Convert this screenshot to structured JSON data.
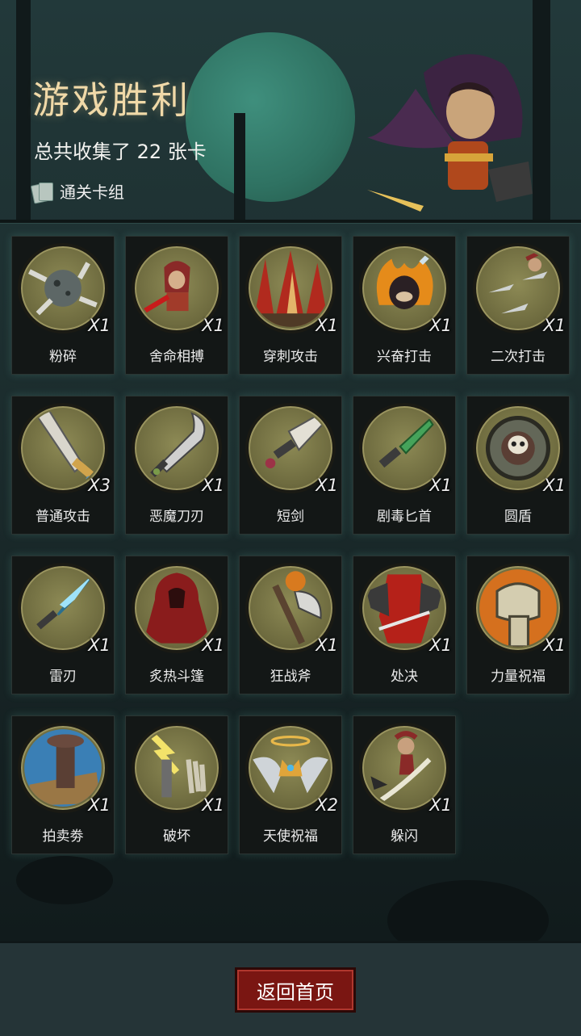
{
  "header": {
    "title": "游戏胜利",
    "subtitle": "总共收集了 22 张卡",
    "deck_label": "通关卡组"
  },
  "cards": [
    {
      "name": "粉碎",
      "count": "X1",
      "icon": "shattered-ball-icon"
    },
    {
      "name": "舍命相搏",
      "count": "X1",
      "icon": "hooded-fighter-icon"
    },
    {
      "name": "穿刺攻击",
      "count": "X1",
      "icon": "spike-trap-icon"
    },
    {
      "name": "兴奋打击",
      "count": "X1",
      "icon": "flaming-rogue-icon"
    },
    {
      "name": "二次打击",
      "count": "X1",
      "icon": "thrown-daggers-icon"
    },
    {
      "name": "普通攻击",
      "count": "X3",
      "icon": "broadsword-icon"
    },
    {
      "name": "恶魔刀刃",
      "count": "X1",
      "icon": "demon-blade-icon"
    },
    {
      "name": "短剑",
      "count": "X1",
      "icon": "short-sword-icon"
    },
    {
      "name": "剧毒匕首",
      "count": "X1",
      "icon": "poison-dagger-icon"
    },
    {
      "name": "圆盾",
      "count": "X1",
      "icon": "round-shield-icon"
    },
    {
      "name": "雷刃",
      "count": "X1",
      "icon": "thunder-blade-icon"
    },
    {
      "name": "炙热斗篷",
      "count": "X1",
      "icon": "red-cloak-icon"
    },
    {
      "name": "狂战斧",
      "count": "X1",
      "icon": "berserker-axe-icon"
    },
    {
      "name": "处决",
      "count": "X1",
      "icon": "execution-icon"
    },
    {
      "name": "力量祝福",
      "count": "X1",
      "icon": "fist-icon"
    },
    {
      "name": "拍卖劵",
      "count": "X1",
      "icon": "gavel-icon"
    },
    {
      "name": "破坏",
      "count": "X1",
      "icon": "lightning-hand-icon"
    },
    {
      "name": "天使祝福",
      "count": "X2",
      "icon": "angel-crown-icon"
    },
    {
      "name": "躲闪",
      "count": "X1",
      "icon": "dodge-icon"
    }
  ],
  "footer": {
    "home_button": "返回首页"
  },
  "colors": {
    "title": "#f0d9a8",
    "button": "#7a1612",
    "disc": "#8d8a55",
    "background": "#1c2a2a"
  }
}
